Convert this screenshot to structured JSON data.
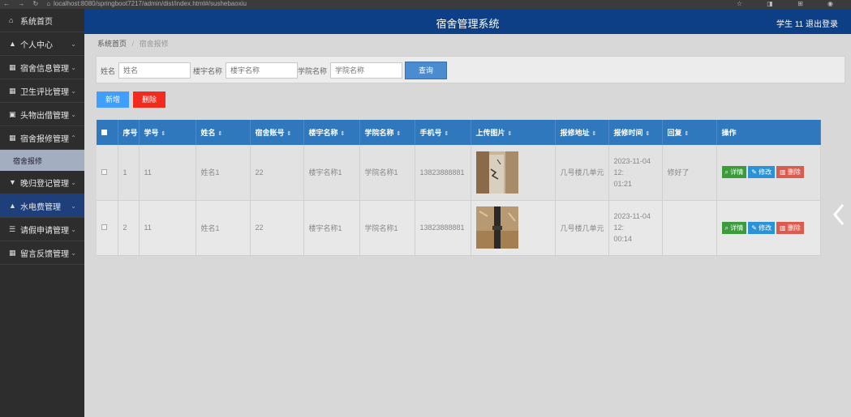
{
  "browser": {
    "nav": "← → ↻ ⌂",
    "url": "localhost:8080/springboot7217/admin/dist/index.html#/sushebaoxiu",
    "right": "☆ ◨ ⊞ ◉"
  },
  "sidebar": {
    "items": [
      {
        "label": "系统首页",
        "icon": "⌂"
      },
      {
        "label": "个人中心",
        "icon": "▲"
      },
      {
        "label": "宿舍信息管理",
        "icon": "▦"
      },
      {
        "label": "卫生评比管理",
        "icon": "▦"
      },
      {
        "label": "头物出借管理",
        "icon": "▣"
      },
      {
        "label": "宿舍报修管理",
        "icon": "▦"
      },
      {
        "label": "晚归登记管理",
        "icon": "▼"
      },
      {
        "label": "水电费管理",
        "icon": "▲"
      },
      {
        "label": "请假申请管理",
        "icon": "☰"
      },
      {
        "label": "留言反馈管理",
        "icon": "▦"
      }
    ],
    "submenu": {
      "label": "宿舍报修"
    }
  },
  "header": {
    "title": "宿舍管理系统",
    "user": "学生 11",
    "logout": "退出登录"
  },
  "breadcrumb": {
    "home": "系统首页",
    "separator": "/",
    "current": "宿舍报修"
  },
  "search": {
    "fields": [
      {
        "label": "姓名",
        "placeholder": "姓名"
      },
      {
        "label": "楼宇名称",
        "placeholder": "楼宇名称"
      },
      {
        "label": "学院名称",
        "placeholder": "学院名称"
      }
    ],
    "button": "查询"
  },
  "actions": {
    "add": "新增",
    "delete": "删除"
  },
  "table": {
    "sort_icon": "⇕",
    "columns": [
      "序号",
      "学号",
      "姓名",
      "宿舍账号",
      "楼宇名称",
      "学院名称",
      "手机号",
      "上传图片",
      "报修地址",
      "报修时间",
      "回复",
      "操作"
    ],
    "rows": [
      {
        "index": "1",
        "student_no": "11",
        "name": "姓名1",
        "dorm_account": "22",
        "building": "楼宇名称1",
        "college": "学院名称1",
        "phone": "13823888881",
        "address": "几号楼几单元",
        "time_date": "2023-11-04 12:",
        "time_clock": "01:21",
        "reply": "修好了"
      },
      {
        "index": "2",
        "student_no": "11",
        "name": "姓名1",
        "dorm_account": "22",
        "building": "楼宇名称1",
        "college": "学院名称1",
        "phone": "13823888881",
        "address": "几号楼几单元",
        "time_date": "2023-11-04 12:",
        "time_clock": "00:14",
        "reply": ""
      }
    ],
    "ops": {
      "detail": "详情",
      "edit": "修改",
      "remove": "删除"
    }
  },
  "colors": {
    "header": "#0c3f86",
    "sidebar": "#2d2d2d",
    "table_head": "#2f78be",
    "add_button": "#409eff",
    "delete_button": "#f32b1f"
  }
}
